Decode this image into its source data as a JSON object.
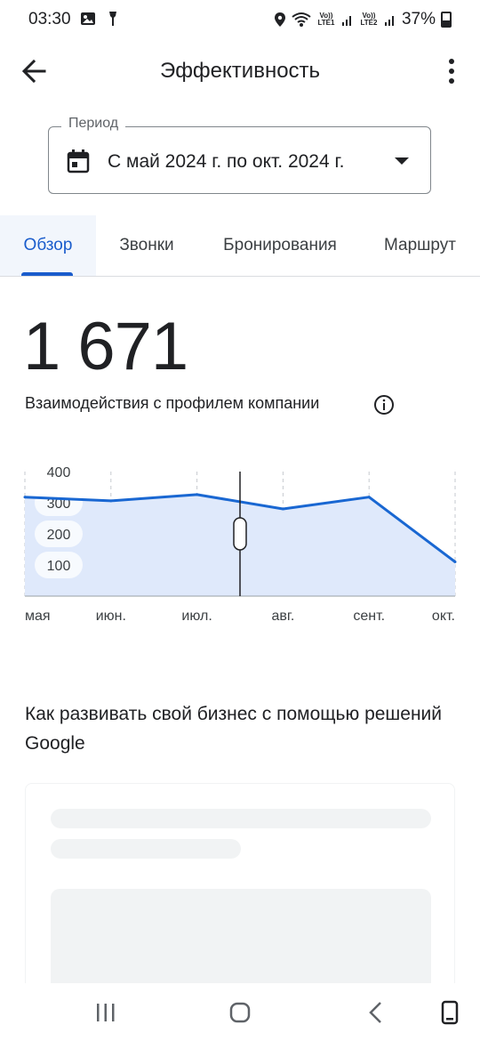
{
  "status_bar": {
    "time": "03:30",
    "battery": "37%",
    "sim1_label": "Vo)) LTE1",
    "sim2_label": "Vo)) LTE2",
    "icons": [
      "image-icon",
      "flashlight-icon",
      "location-icon",
      "wifi-icon",
      "signal-icon",
      "battery-icon"
    ]
  },
  "app_bar": {
    "title": "Эффективность",
    "back_icon": "arrow-back-icon",
    "more_icon": "more-vert-icon"
  },
  "period": {
    "label": "Период",
    "value": "С май 2024 г. по окт. 2024 г.",
    "icon": "calendar-icon"
  },
  "tabs": [
    {
      "label": "Обзор",
      "active": true
    },
    {
      "label": "Звонки",
      "active": false
    },
    {
      "label": "Бронирования",
      "active": false
    },
    {
      "label": "Маршрут",
      "active": false
    }
  ],
  "metric": {
    "value": "1 671",
    "label": "Взаимодействия с профилем компании"
  },
  "chart_data": {
    "type": "area",
    "categories": [
      "мая",
      "июн.",
      "июл.",
      "авг.",
      "сент.",
      "окт."
    ],
    "series": [
      {
        "values": [
          318,
          306,
          326,
          280,
          318,
          110
        ],
        "color": "#1967d2"
      }
    ],
    "y_ticks": [
      100,
      200,
      300,
      400
    ],
    "ylim": [
      0,
      400
    ],
    "grid": "vertical dashed",
    "fill_color": "#dfe9fb"
  },
  "section": {
    "heading": "Как развивать свой бизнес с помощью решений Google"
  },
  "nav_bar": {
    "icons": [
      "recent-apps-icon",
      "home-icon",
      "back-icon",
      "screen-rotate-icon"
    ]
  }
}
